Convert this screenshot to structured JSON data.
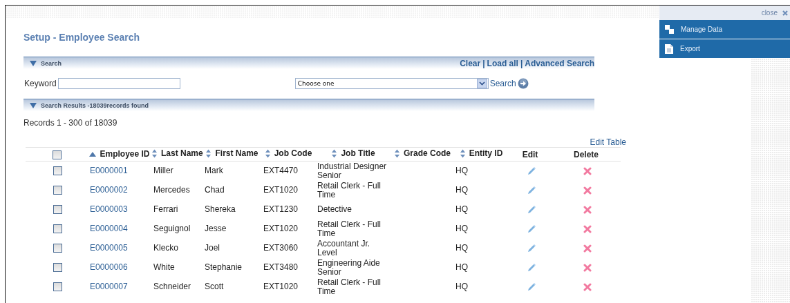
{
  "page": {
    "title": "Setup - Employee Search"
  },
  "search_panel": {
    "title": "Search",
    "expanded": true,
    "links": [
      {
        "kind": "link",
        "text": "Clear"
      },
      {
        "kind": "separator",
        "text": "|"
      },
      {
        "kind": "link",
        "text": "Load all"
      },
      {
        "kind": "separator",
        "text": "|"
      },
      {
        "kind": "link",
        "text": "Advanced Search"
      }
    ],
    "keyword_label": "Keyword",
    "select_value": "Choose one",
    "search_button": "Search"
  },
  "results_panel": {
    "title": "Search Results -18039records found",
    "expanded": true
  },
  "records_summary": "Records 1 - 300 of 18039",
  "edit_table_link": "Edit Table",
  "table": {
    "select_all": {
      "checked": false
    },
    "columns": [
      {
        "label": "Employee ID",
        "kind": "sortable",
        "sorted": true
      },
      {
        "label": "Last Name",
        "kind": "sortable",
        "sorted": false
      },
      {
        "label": "First Name",
        "kind": "sortable",
        "sorted": false
      },
      {
        "label": "Job Code",
        "kind": "sortable",
        "sorted": false
      },
      {
        "label": "Job Title",
        "kind": "sortable",
        "sorted": false
      },
      {
        "label": "Grade Code",
        "kind": "sortable",
        "sorted": false
      },
      {
        "label": "Entity ID",
        "kind": "sortable",
        "sorted": false
      },
      {
        "label": "Edit",
        "kind": "plain"
      },
      {
        "label": "Delete",
        "kind": "plain"
      }
    ],
    "rows": [
      {
        "checked": false,
        "cells": [
          "E0000001",
          "Miller",
          "Mark",
          "EXT4470",
          "Industrial Designer Senior",
          "",
          "HQ"
        ]
      },
      {
        "checked": false,
        "cells": [
          "E0000002",
          "Mercedes",
          "Chad",
          "EXT1020",
          "Retail Clerk - Full Time",
          "",
          "HQ"
        ]
      },
      {
        "checked": false,
        "cells": [
          "E0000003",
          "Ferrari",
          "Shereka",
          "EXT1230",
          "Detective",
          "",
          "HQ"
        ]
      },
      {
        "checked": false,
        "cells": [
          "E0000004",
          "Seguignol",
          "Jesse",
          "EXT1020",
          "Retail Clerk - Full Time",
          "",
          "HQ"
        ]
      },
      {
        "checked": false,
        "cells": [
          "E0000005",
          "Klecko",
          "Joel",
          "EXT3060",
          "Accountant Jr. Level",
          "",
          "HQ"
        ]
      },
      {
        "checked": false,
        "cells": [
          "E0000006",
          "White",
          "Stephanie",
          "EXT3480",
          "Engineering Aide Senior",
          "",
          "HQ"
        ]
      },
      {
        "checked": false,
        "cells": [
          "E0000007",
          "Schneider",
          "Scott",
          "EXT1020",
          "Retail Clerk - Full Time",
          "",
          "HQ"
        ]
      }
    ]
  },
  "side_panel": {
    "close_label": "close",
    "items": [
      {
        "label": "Manage Data"
      },
      {
        "label": "Export"
      }
    ]
  }
}
